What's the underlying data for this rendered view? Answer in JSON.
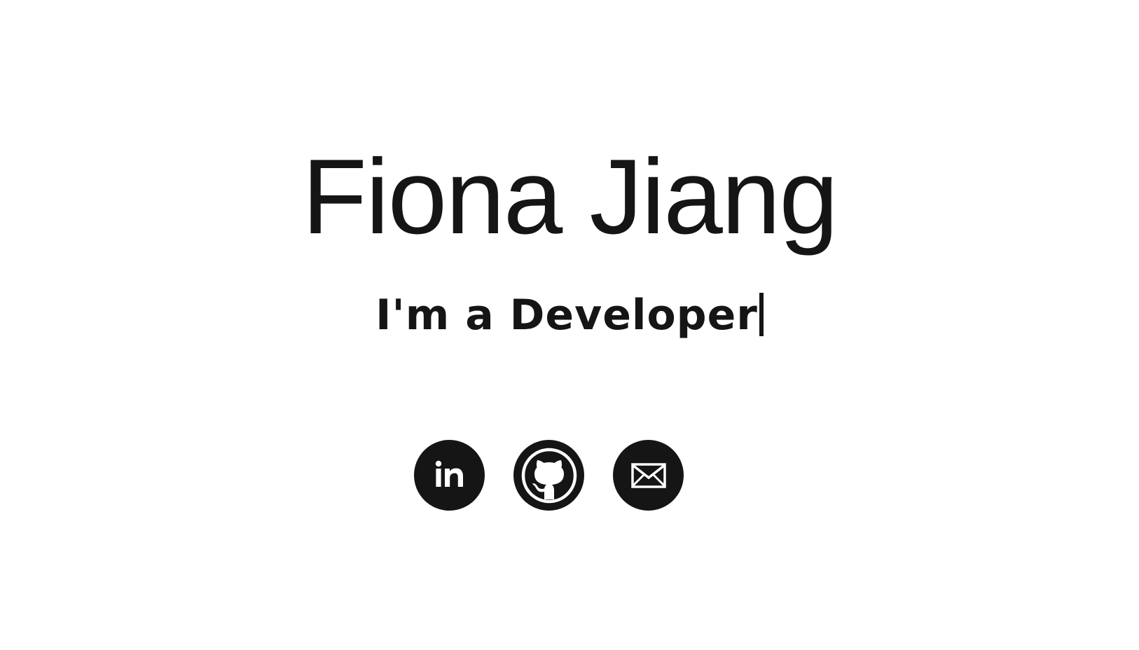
{
  "hero": {
    "name": "Fiona Jiang",
    "tagline_prefix": "I'm a",
    "tagline_role": "Developer"
  },
  "socials": [
    {
      "icon": "linkedin-icon"
    },
    {
      "icon": "github-icon"
    },
    {
      "icon": "mail-icon"
    }
  ],
  "colors": {
    "text": "#151515",
    "background": "#ffffff",
    "icon_background": "#151515",
    "icon_foreground": "#ffffff"
  }
}
